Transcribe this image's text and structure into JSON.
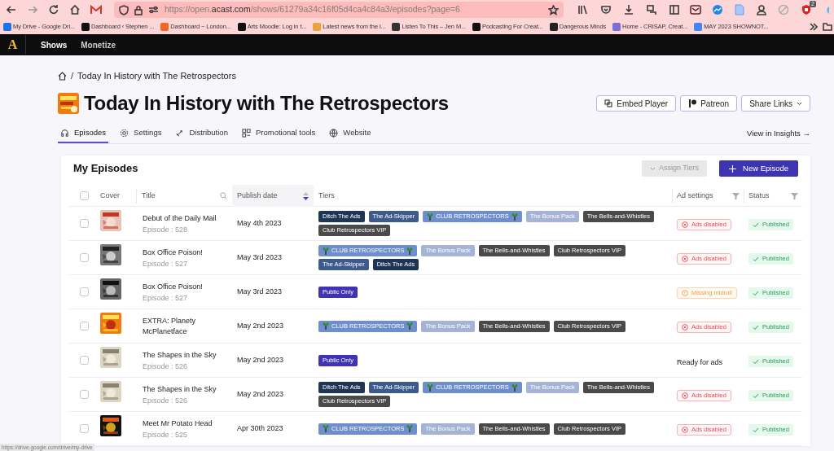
{
  "browser": {
    "url_scheme": "https://open.",
    "url_domain": "acast.com",
    "url_path": "/shows/61279a34c16f05d4ca4c84a3/episodes?page=6",
    "extension_badge": "2",
    "bookmarks": [
      {
        "label": "My Drive - Google Dri...",
        "color": "#1a73e8"
      },
      {
        "label": "Dashboard ‹ Stephen ...",
        "color": "#111111"
      },
      {
        "label": "Dashboard ~ London...",
        "color": "#f26522"
      },
      {
        "label": "Arts Moodle: Log in t...",
        "color": "#111111"
      },
      {
        "label": "Latest news from the l...",
        "color": "#e8a33d"
      },
      {
        "label": "Listen To This – Jen M...",
        "color": "#333333"
      },
      {
        "label": "Podcasting For Creat...",
        "color": "#111111"
      },
      {
        "label": "Dangerous Minds",
        "color": "#222222"
      },
      {
        "label": "Home - CRISAP, Creat...",
        "color": "#7b6fd6"
      },
      {
        "label": "MAY 2023 SHOWNOT...",
        "color": "#4285f4"
      }
    ],
    "status_link": "https://drive.google.com/drive/my-drive"
  },
  "app_nav": {
    "logo": "A",
    "items": [
      {
        "label": "Shows",
        "selected": true
      },
      {
        "label": "Monetize",
        "selected": false
      }
    ]
  },
  "breadcrumb_separator": "/",
  "breadcrumb": "Today In History with The Retrospectors",
  "show_title": "Today In History with The Retrospectors",
  "header_buttons": [
    "Embed Player",
    "Patreon",
    "Share Links"
  ],
  "tabs": [
    {
      "label": "Episodes",
      "selected": true
    },
    {
      "label": "Settings",
      "selected": false
    },
    {
      "label": "Distribution",
      "selected": false
    },
    {
      "label": "Promotional tools",
      "selected": false
    },
    {
      "label": "Website",
      "selected": false
    }
  ],
  "insights_link": "View in Insights →",
  "card": {
    "title": "My Episodes",
    "assign_button": {
      "label": "Assign Tiers",
      "disabled": true
    },
    "new_button": "New Episode"
  },
  "table": {
    "select_all_checked": false,
    "columns": [
      "Cover",
      "Title",
      "Publish date",
      "Tiers",
      "Ad settings",
      "Status"
    ],
    "rows": [
      {
        "checked": false,
        "title": "Debut of the Daily Mail",
        "episode": "Episode : 528",
        "date": "May 4th 2023",
        "tiers": [
          {
            "label": "Ditch The Ads",
            "kind": "plain",
            "color": "#1f3556"
          },
          {
            "label": "The Ad-Skipper",
            "kind": "plain",
            "color": "#3d5a8c"
          },
          {
            "label": "CLUB RETROSPECTORS",
            "kind": "club",
            "color": "#6f8fcc"
          },
          {
            "label": "The Bonus Pack",
            "kind": "plain",
            "color": "#a5b4d6"
          },
          {
            "label": "The Bells-and-Whistles",
            "kind": "plain",
            "color": "#4a4a4a"
          },
          {
            "label": "Club Retrospectors VIP",
            "kind": "plain",
            "color": "#4a4a4a"
          }
        ],
        "ad": {
          "kind": "disabled",
          "label": "Ads disabled"
        },
        "status": "Published"
      },
      {
        "checked": false,
        "title": "Box Office Poison!",
        "episode": "Episode : 527",
        "date": "May 3rd 2023",
        "tiers": [
          {
            "label": "CLUB RETROSPECTORS",
            "kind": "club",
            "color": "#6f8fcc"
          },
          {
            "label": "The Bonus Pack",
            "kind": "plain",
            "color": "#a5b4d6"
          },
          {
            "label": "The Bells-and-Whistles",
            "kind": "plain",
            "color": "#4a4a4a"
          },
          {
            "label": "Club Retrospectors VIP",
            "kind": "plain",
            "color": "#4a4a4a"
          },
          {
            "label": "The Ad-Skipper",
            "kind": "plain",
            "color": "#3d5a8c"
          },
          {
            "label": "Ditch The Ads",
            "kind": "plain",
            "color": "#1f3556"
          }
        ],
        "ad": {
          "kind": "disabled",
          "label": "Ads disabled"
        },
        "status": "Published"
      },
      {
        "checked": false,
        "title": "Box Office Poison!",
        "episode": "Episode : 527",
        "date": "May 3rd 2023",
        "tiers": [
          {
            "label": "Public Only",
            "kind": "plain",
            "color": "#3e33b0"
          }
        ],
        "ad": {
          "kind": "missing",
          "label": "Missing midroll"
        },
        "status": "Published"
      },
      {
        "checked": false,
        "title": "EXTRA: Planety McPlanetface",
        "date": "May 2nd 2023",
        "tiers": [
          {
            "label": "CLUB RETROSPECTORS",
            "kind": "club",
            "color": "#6f8fcc"
          },
          {
            "label": "The Bonus Pack",
            "kind": "plain",
            "color": "#a5b4d6"
          },
          {
            "label": "The Bells-and-Whistles",
            "kind": "plain",
            "color": "#4a4a4a"
          },
          {
            "label": "Club Retrospectors VIP",
            "kind": "plain",
            "color": "#4a4a4a"
          }
        ],
        "ad": {
          "kind": "disabled",
          "label": "Ads disabled"
        },
        "status": "Published"
      },
      {
        "checked": false,
        "title": "The Shapes in the Sky",
        "episode": "Episode : 526",
        "date": "May 2nd 2023",
        "tiers": [
          {
            "label": "Public Only",
            "kind": "plain",
            "color": "#3e33b0"
          }
        ],
        "ad": {
          "kind": "ready",
          "label": "Ready for ads"
        },
        "status": "Published"
      },
      {
        "checked": false,
        "title": "The Shapes in the Sky",
        "episode": "Episode : 526",
        "date": "May 2nd 2023",
        "tiers": [
          {
            "label": "Ditch The Ads",
            "kind": "plain",
            "color": "#1f3556"
          },
          {
            "label": "The Ad-Skipper",
            "kind": "plain",
            "color": "#3d5a8c"
          },
          {
            "label": "CLUB RETROSPECTORS",
            "kind": "club",
            "color": "#6f8fcc"
          },
          {
            "label": "The Bonus Pack",
            "kind": "plain",
            "color": "#a5b4d6"
          },
          {
            "label": "The Bells-and-Whistles",
            "kind": "plain",
            "color": "#4a4a4a"
          },
          {
            "label": "Club Retrospectors VIP",
            "kind": "plain",
            "color": "#4a4a4a"
          }
        ],
        "ad": {
          "kind": "disabled",
          "label": "Ads disabled"
        },
        "status": "Published"
      },
      {
        "checked": false,
        "title": "Meet Mr Potato Head",
        "episode": "Episode : 525",
        "date": "Apr 30th 2023",
        "tiers": [
          {
            "label": "CLUB RETROSPECTORS",
            "kind": "club",
            "color": "#6f8fcc"
          },
          {
            "label": "The Bonus Pack",
            "kind": "plain",
            "color": "#a5b4d6"
          },
          {
            "label": "The Bells-and-Whistles",
            "kind": "plain",
            "color": "#4a4a4a"
          },
          {
            "label": "Club Retrospectors VIP",
            "kind": "plain",
            "color": "#4a4a4a"
          }
        ],
        "ad": {
          "kind": "disabled",
          "label": "Ads disabled"
        },
        "status": "Published"
      }
    ]
  }
}
